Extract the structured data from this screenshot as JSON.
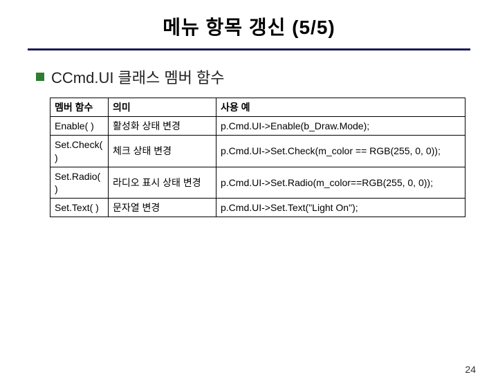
{
  "title": "메뉴 항목 갱신 (5/5)",
  "subtitle": "CCmd.UI 클래스 멤버 함수",
  "table": {
    "headers": {
      "col1": "멤버 함수",
      "col2": "의미",
      "col3": "사용 예"
    },
    "rows": [
      {
        "name": "Enable( )",
        "meaning": "활성화 상태 변경",
        "example": "p.Cmd.UI->Enable(b_Draw.Mode);"
      },
      {
        "name": "Set.Check( )",
        "meaning": "체크 상태 변경",
        "example": "p.Cmd.UI->Set.Check(m_color == RGB(255, 0, 0));"
      },
      {
        "name": "Set.Radio( )",
        "meaning": "라디오 표시 상태 변경",
        "example": "p.Cmd.UI->Set.Radio(m_color==RGB(255, 0, 0));"
      },
      {
        "name": "Set.Text( )",
        "meaning": "문자열 변경",
        "example": "p.Cmd.UI->Set.Text(\"Light On\");"
      }
    ]
  },
  "page_number": "24"
}
